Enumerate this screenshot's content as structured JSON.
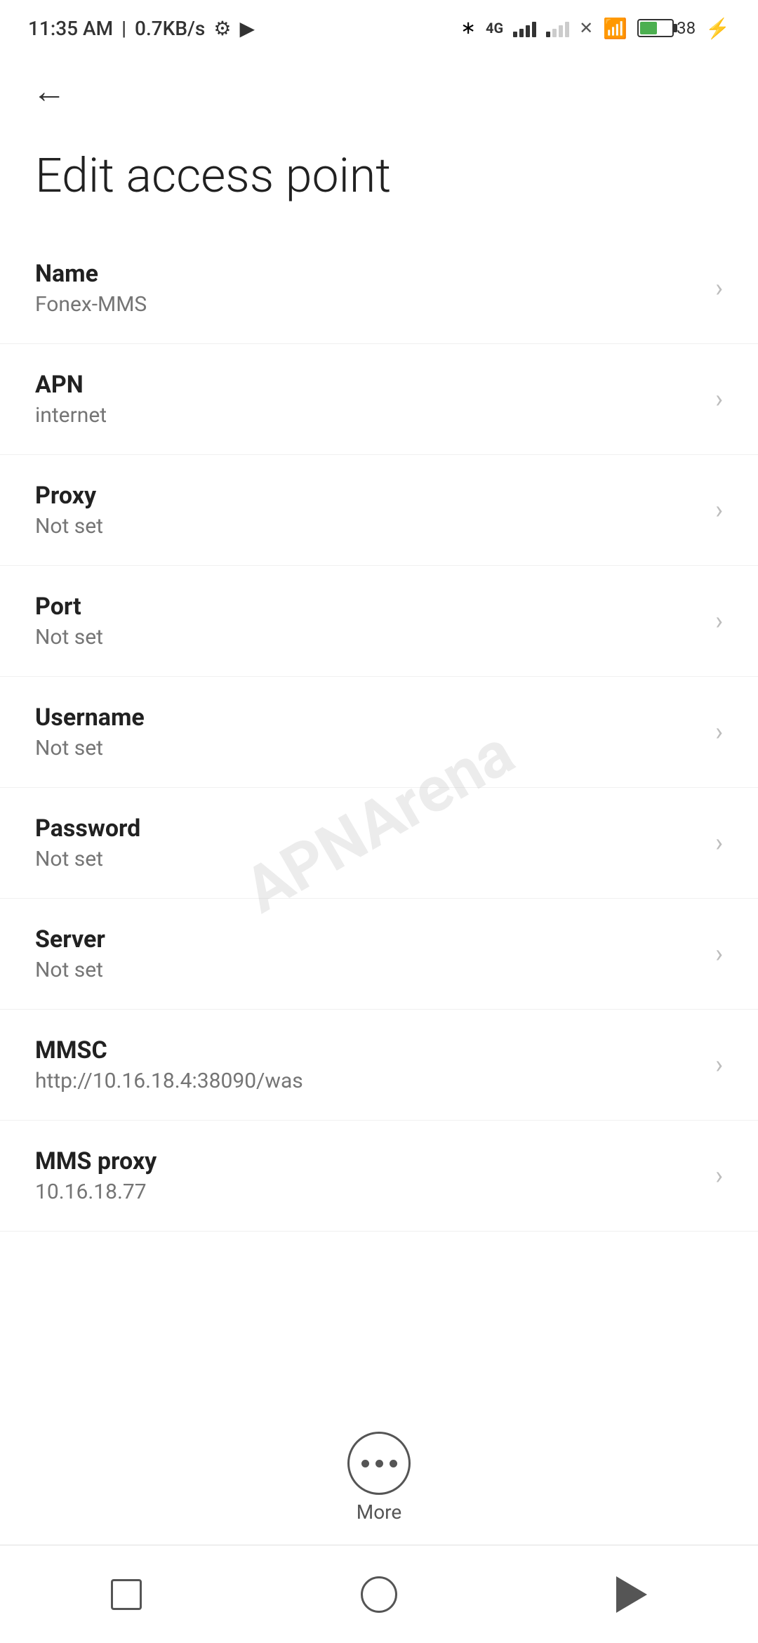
{
  "statusBar": {
    "time": "11:35 AM",
    "speed": "0.7KB/s"
  },
  "navigation": {
    "back_label": "←"
  },
  "page": {
    "title": "Edit access point"
  },
  "settings": [
    {
      "label": "Name",
      "value": "Fonex-MMS"
    },
    {
      "label": "APN",
      "value": "internet"
    },
    {
      "label": "Proxy",
      "value": "Not set"
    },
    {
      "label": "Port",
      "value": "Not set"
    },
    {
      "label": "Username",
      "value": "Not set"
    },
    {
      "label": "Password",
      "value": "Not set"
    },
    {
      "label": "Server",
      "value": "Not set"
    },
    {
      "label": "MMSC",
      "value": "http://10.16.18.4:38090/was"
    },
    {
      "label": "MMS proxy",
      "value": "10.16.18.77"
    }
  ],
  "more": {
    "label": "More"
  },
  "watermark": {
    "text": "APNArena"
  }
}
